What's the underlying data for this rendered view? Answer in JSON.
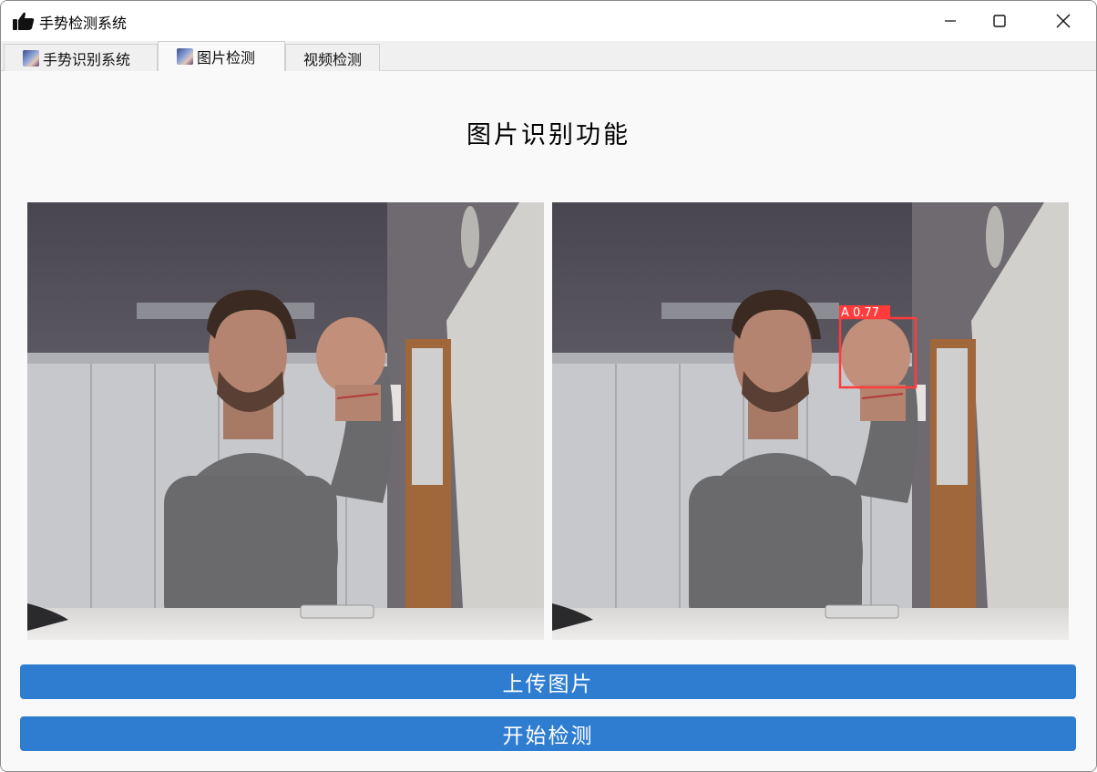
{
  "window": {
    "title": "手势检测系统",
    "icon": "thumbs-up-icon"
  },
  "tabs": [
    {
      "label": "手势识别系统",
      "icon": "tab-image-icon",
      "active": false
    },
    {
      "label": "图片检测",
      "icon": "tab-image-icon",
      "active": true
    },
    {
      "label": "视频检测",
      "active": false
    }
  ],
  "main": {
    "title": "图片识别功能",
    "original_image": {
      "description_name": "original-photo"
    },
    "result_image": {
      "detection": {
        "label": "A",
        "confidence": "0.77",
        "color": "#ff3b3b"
      }
    },
    "upload_button": "上传图片",
    "detect_button": "开始检测"
  },
  "colors": {
    "accent": "#2f7dd1"
  }
}
